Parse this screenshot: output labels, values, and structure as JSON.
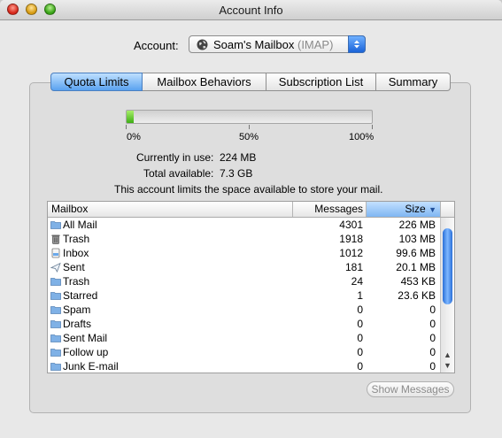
{
  "window": {
    "title": "Account Info"
  },
  "account": {
    "label": "Account:",
    "name": "Soam's Mailbox",
    "type": "(IMAP)"
  },
  "tabs": [
    {
      "label": "Quota Limits"
    },
    {
      "label": "Mailbox Behaviors"
    },
    {
      "label": "Subscription List"
    },
    {
      "label": "Summary"
    }
  ],
  "quota": {
    "usage_fraction": 0.03,
    "scale": [
      "0%",
      "50%",
      "100%"
    ],
    "in_use_label": "Currently in use:",
    "in_use_value": "224 MB",
    "available_label": "Total available:",
    "available_value": "7.3 GB",
    "note": "This account limits the space available to store your mail."
  },
  "table": {
    "columns": {
      "mailbox": "Mailbox",
      "messages": "Messages",
      "size": "Size"
    },
    "sort_indicator": "▼",
    "rows": [
      {
        "icon": "folder-icon",
        "name": "All Mail",
        "messages": "4301",
        "size": "226 MB"
      },
      {
        "icon": "trash-icon",
        "name": "Trash",
        "messages": "1918",
        "size": "103 MB"
      },
      {
        "icon": "inbox-icon",
        "name": "Inbox",
        "messages": "1012",
        "size": "99.6 MB"
      },
      {
        "icon": "sent-icon",
        "name": "Sent",
        "messages": "181",
        "size": "20.1 MB"
      },
      {
        "icon": "folder-icon",
        "name": "Trash",
        "messages": "24",
        "size": "453 KB"
      },
      {
        "icon": "folder-icon",
        "name": "Starred",
        "messages": "1",
        "size": "23.6 KB"
      },
      {
        "icon": "folder-icon",
        "name": "Spam",
        "messages": "0",
        "size": "0"
      },
      {
        "icon": "folder-icon",
        "name": "Drafts",
        "messages": "0",
        "size": "0"
      },
      {
        "icon": "folder-icon",
        "name": "Sent Mail",
        "messages": "0",
        "size": "0"
      },
      {
        "icon": "folder-icon",
        "name": "Follow up",
        "messages": "0",
        "size": "0"
      },
      {
        "icon": "folder-icon",
        "name": "Junk E-mail",
        "messages": "0",
        "size": "0"
      }
    ],
    "scroll": {
      "thumb_start_fraction": 0.08,
      "thumb_length_fraction": 0.58
    }
  },
  "buttons": {
    "show_messages": "Show Messages"
  },
  "colors": {
    "accent": "#3d7fe0",
    "quota_fill": "#3dae14",
    "folder": "#7fb1e6"
  }
}
